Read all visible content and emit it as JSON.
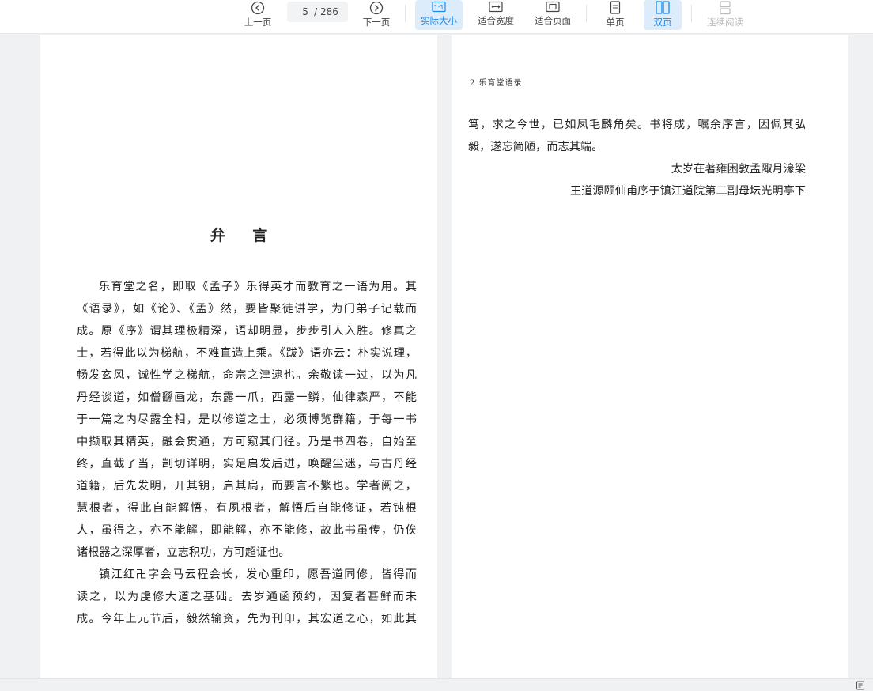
{
  "toolbar": {
    "prev_label": "上一页",
    "page_current": "5",
    "page_total": "/ 286",
    "next_label": "下一页",
    "actual_size_label": "实际大小",
    "fit_width_label": "适合宽度",
    "fit_page_label": "适合页面",
    "single_page_label": "单页",
    "double_page_label": "双页",
    "continuous_label": "连续阅读"
  },
  "left_page": {
    "title": "弁  言",
    "lines": [
      "乐育堂之名，即取《孟子》乐得英才而教育之一语为用。其",
      "《语录》，如《论》、《孟》然，要皆聚徒讲学，为门弟子记载而",
      "成。原《序》谓其理极精深，语却明显，步步引人入胜。修真之",
      "士，若得此以为梯航，不难直造上乘。《跋》语亦云：朴实说理，",
      "畅发玄风，诚性学之梯航，命宗之津逮也。余敬读一过，以为凡",
      "丹经谈道，如僧繇画龙，东露一爪，西露一鳞，仙律森严，不能",
      "于一篇之内尽露全相，是以修道之士，必须博览群籍，于每一书",
      "中撷取其精英，融会贯通，方可窥其门径。乃是书四卷，自始至",
      "终，直截了当，剀切详明，实足启发后进，唤醒尘迷，与古丹经",
      "道籍，后先发明，开其钥，启其扃，而要言不繁也。学者阅之，",
      "慧根者，得此自能解悟，有夙根者，解悟后自能修证，若钝根",
      "人，虽得之，亦不能解，即能解，亦不能修，故此书虽传，仍俟",
      "诸根器之深厚者，立志积功，方可超证也。",
      "镇江红卍字会马云程会长，发心重印，愿吾道同修，皆得而",
      "读之，以为虔修大道之基础。去岁通函预约，因复者甚鲜而未",
      "成。今年上元节后，毅然输资，先为刊印，其宏道之心，如此其"
    ]
  },
  "right_page": {
    "running_head": "2   乐育堂语录",
    "lines": [
      "笃，求之今世，已如凤毛麟角矣。书将成，嘱余序言，因佩其弘",
      "毅，遂忘简陋，而志其端。",
      "太岁在著雍困敦孟陬月濠梁",
      "王道源颐仙甫序于镇江道院第二副母坛光明亭下"
    ]
  },
  "colors": {
    "accent": "#1e88e5",
    "active_bg": "#dcecfb",
    "background": "#f0f1f3",
    "page": "#ffffff"
  }
}
